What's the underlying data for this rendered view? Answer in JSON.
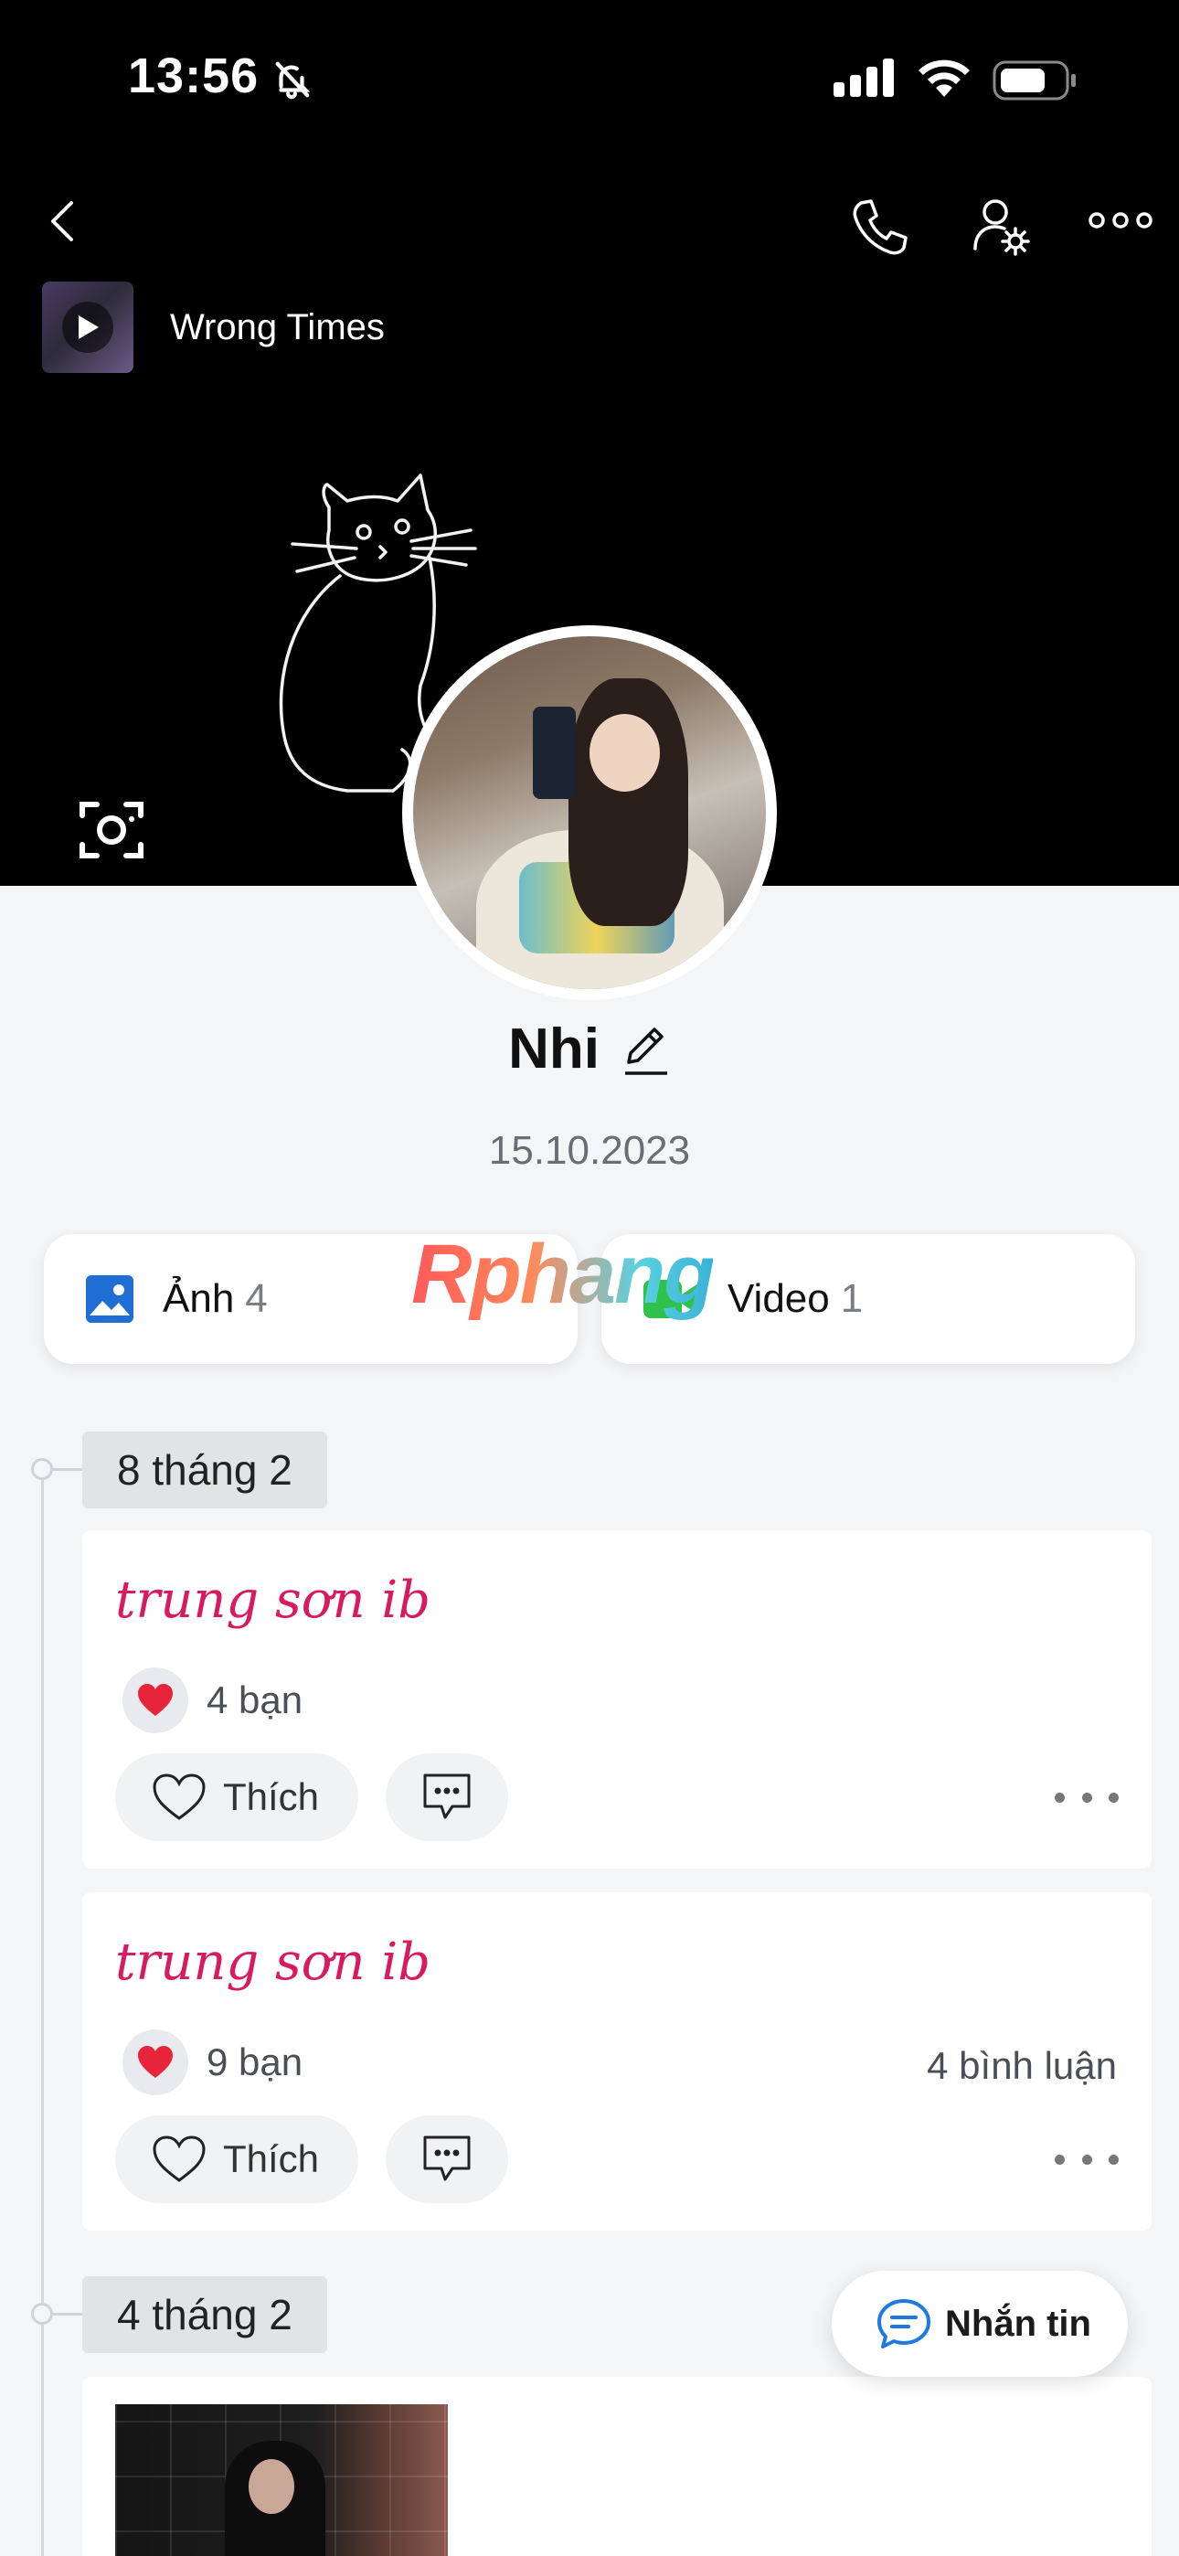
{
  "status_bar": {
    "time": "13:56"
  },
  "music": {
    "title": "Wrong Times"
  },
  "profile": {
    "name": "Nhi",
    "date": "15.10.2023"
  },
  "media": {
    "photos": {
      "label": "Ảnh",
      "count": "4"
    },
    "videos": {
      "label": "Video",
      "count": "1"
    }
  },
  "watermark": "Rphang",
  "timeline": {
    "group1": {
      "date": "8 tháng 2"
    },
    "group2": {
      "date": "4 tháng 2"
    }
  },
  "posts": [
    {
      "text": "trung sơn ib",
      "reactions": "4 bạn",
      "comments": "",
      "like_label": "Thích"
    },
    {
      "text": "trung sơn ib",
      "reactions": "9 bạn",
      "comments": "4 bình luận",
      "like_label": "Thích"
    }
  ],
  "fab": {
    "label": "Nhắn tin"
  },
  "icons": {
    "back": "chevron-left-icon",
    "call": "phone-icon",
    "settings": "user-settings-icon",
    "more": "more-horizontal-icon",
    "camera": "camera-rotate-icon",
    "photo": "image-icon",
    "video": "video-icon",
    "heart": "heart-icon",
    "comment": "comment-icon",
    "message": "chat-bubble-icon"
  },
  "colors": {
    "accent_pink": "#d81b60",
    "photo_icon": "#1f6ed4",
    "video_icon": "#2fc24a",
    "heart_red": "#e8243b",
    "message_blue": "#1f7ae0"
  }
}
